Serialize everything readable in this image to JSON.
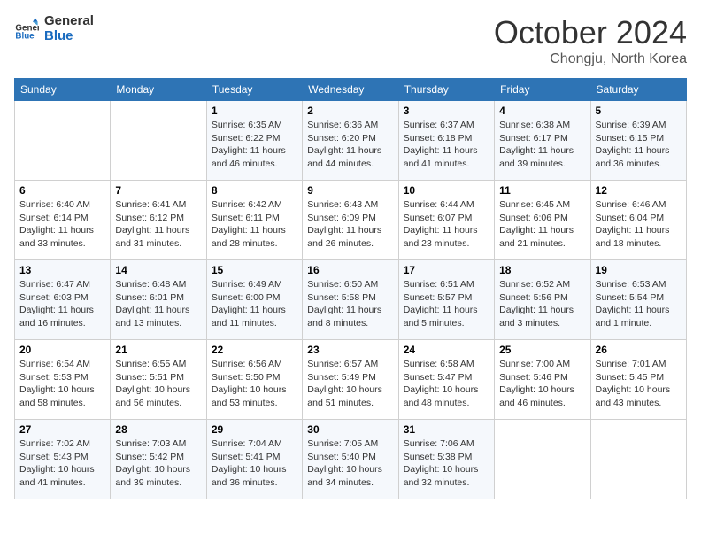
{
  "logo": {
    "line1": "General",
    "line2": "Blue"
  },
  "title": "October 2024",
  "location": "Chongju, North Korea",
  "days_header": [
    "Sunday",
    "Monday",
    "Tuesday",
    "Wednesday",
    "Thursday",
    "Friday",
    "Saturday"
  ],
  "weeks": [
    [
      {
        "day": "",
        "info": ""
      },
      {
        "day": "",
        "info": ""
      },
      {
        "day": "1",
        "info": "Sunrise: 6:35 AM\nSunset: 6:22 PM\nDaylight: 11 hours and 46 minutes."
      },
      {
        "day": "2",
        "info": "Sunrise: 6:36 AM\nSunset: 6:20 PM\nDaylight: 11 hours and 44 minutes."
      },
      {
        "day": "3",
        "info": "Sunrise: 6:37 AM\nSunset: 6:18 PM\nDaylight: 11 hours and 41 minutes."
      },
      {
        "day": "4",
        "info": "Sunrise: 6:38 AM\nSunset: 6:17 PM\nDaylight: 11 hours and 39 minutes."
      },
      {
        "day": "5",
        "info": "Sunrise: 6:39 AM\nSunset: 6:15 PM\nDaylight: 11 hours and 36 minutes."
      }
    ],
    [
      {
        "day": "6",
        "info": "Sunrise: 6:40 AM\nSunset: 6:14 PM\nDaylight: 11 hours and 33 minutes."
      },
      {
        "day": "7",
        "info": "Sunrise: 6:41 AM\nSunset: 6:12 PM\nDaylight: 11 hours and 31 minutes."
      },
      {
        "day": "8",
        "info": "Sunrise: 6:42 AM\nSunset: 6:11 PM\nDaylight: 11 hours and 28 minutes."
      },
      {
        "day": "9",
        "info": "Sunrise: 6:43 AM\nSunset: 6:09 PM\nDaylight: 11 hours and 26 minutes."
      },
      {
        "day": "10",
        "info": "Sunrise: 6:44 AM\nSunset: 6:07 PM\nDaylight: 11 hours and 23 minutes."
      },
      {
        "day": "11",
        "info": "Sunrise: 6:45 AM\nSunset: 6:06 PM\nDaylight: 11 hours and 21 minutes."
      },
      {
        "day": "12",
        "info": "Sunrise: 6:46 AM\nSunset: 6:04 PM\nDaylight: 11 hours and 18 minutes."
      }
    ],
    [
      {
        "day": "13",
        "info": "Sunrise: 6:47 AM\nSunset: 6:03 PM\nDaylight: 11 hours and 16 minutes."
      },
      {
        "day": "14",
        "info": "Sunrise: 6:48 AM\nSunset: 6:01 PM\nDaylight: 11 hours and 13 minutes."
      },
      {
        "day": "15",
        "info": "Sunrise: 6:49 AM\nSunset: 6:00 PM\nDaylight: 11 hours and 11 minutes."
      },
      {
        "day": "16",
        "info": "Sunrise: 6:50 AM\nSunset: 5:58 PM\nDaylight: 11 hours and 8 minutes."
      },
      {
        "day": "17",
        "info": "Sunrise: 6:51 AM\nSunset: 5:57 PM\nDaylight: 11 hours and 5 minutes."
      },
      {
        "day": "18",
        "info": "Sunrise: 6:52 AM\nSunset: 5:56 PM\nDaylight: 11 hours and 3 minutes."
      },
      {
        "day": "19",
        "info": "Sunrise: 6:53 AM\nSunset: 5:54 PM\nDaylight: 11 hours and 1 minute."
      }
    ],
    [
      {
        "day": "20",
        "info": "Sunrise: 6:54 AM\nSunset: 5:53 PM\nDaylight: 10 hours and 58 minutes."
      },
      {
        "day": "21",
        "info": "Sunrise: 6:55 AM\nSunset: 5:51 PM\nDaylight: 10 hours and 56 minutes."
      },
      {
        "day": "22",
        "info": "Sunrise: 6:56 AM\nSunset: 5:50 PM\nDaylight: 10 hours and 53 minutes."
      },
      {
        "day": "23",
        "info": "Sunrise: 6:57 AM\nSunset: 5:49 PM\nDaylight: 10 hours and 51 minutes."
      },
      {
        "day": "24",
        "info": "Sunrise: 6:58 AM\nSunset: 5:47 PM\nDaylight: 10 hours and 48 minutes."
      },
      {
        "day": "25",
        "info": "Sunrise: 7:00 AM\nSunset: 5:46 PM\nDaylight: 10 hours and 46 minutes."
      },
      {
        "day": "26",
        "info": "Sunrise: 7:01 AM\nSunset: 5:45 PM\nDaylight: 10 hours and 43 minutes."
      }
    ],
    [
      {
        "day": "27",
        "info": "Sunrise: 7:02 AM\nSunset: 5:43 PM\nDaylight: 10 hours and 41 minutes."
      },
      {
        "day": "28",
        "info": "Sunrise: 7:03 AM\nSunset: 5:42 PM\nDaylight: 10 hours and 39 minutes."
      },
      {
        "day": "29",
        "info": "Sunrise: 7:04 AM\nSunset: 5:41 PM\nDaylight: 10 hours and 36 minutes."
      },
      {
        "day": "30",
        "info": "Sunrise: 7:05 AM\nSunset: 5:40 PM\nDaylight: 10 hours and 34 minutes."
      },
      {
        "day": "31",
        "info": "Sunrise: 7:06 AM\nSunset: 5:38 PM\nDaylight: 10 hours and 32 minutes."
      },
      {
        "day": "",
        "info": ""
      },
      {
        "day": "",
        "info": ""
      }
    ]
  ]
}
